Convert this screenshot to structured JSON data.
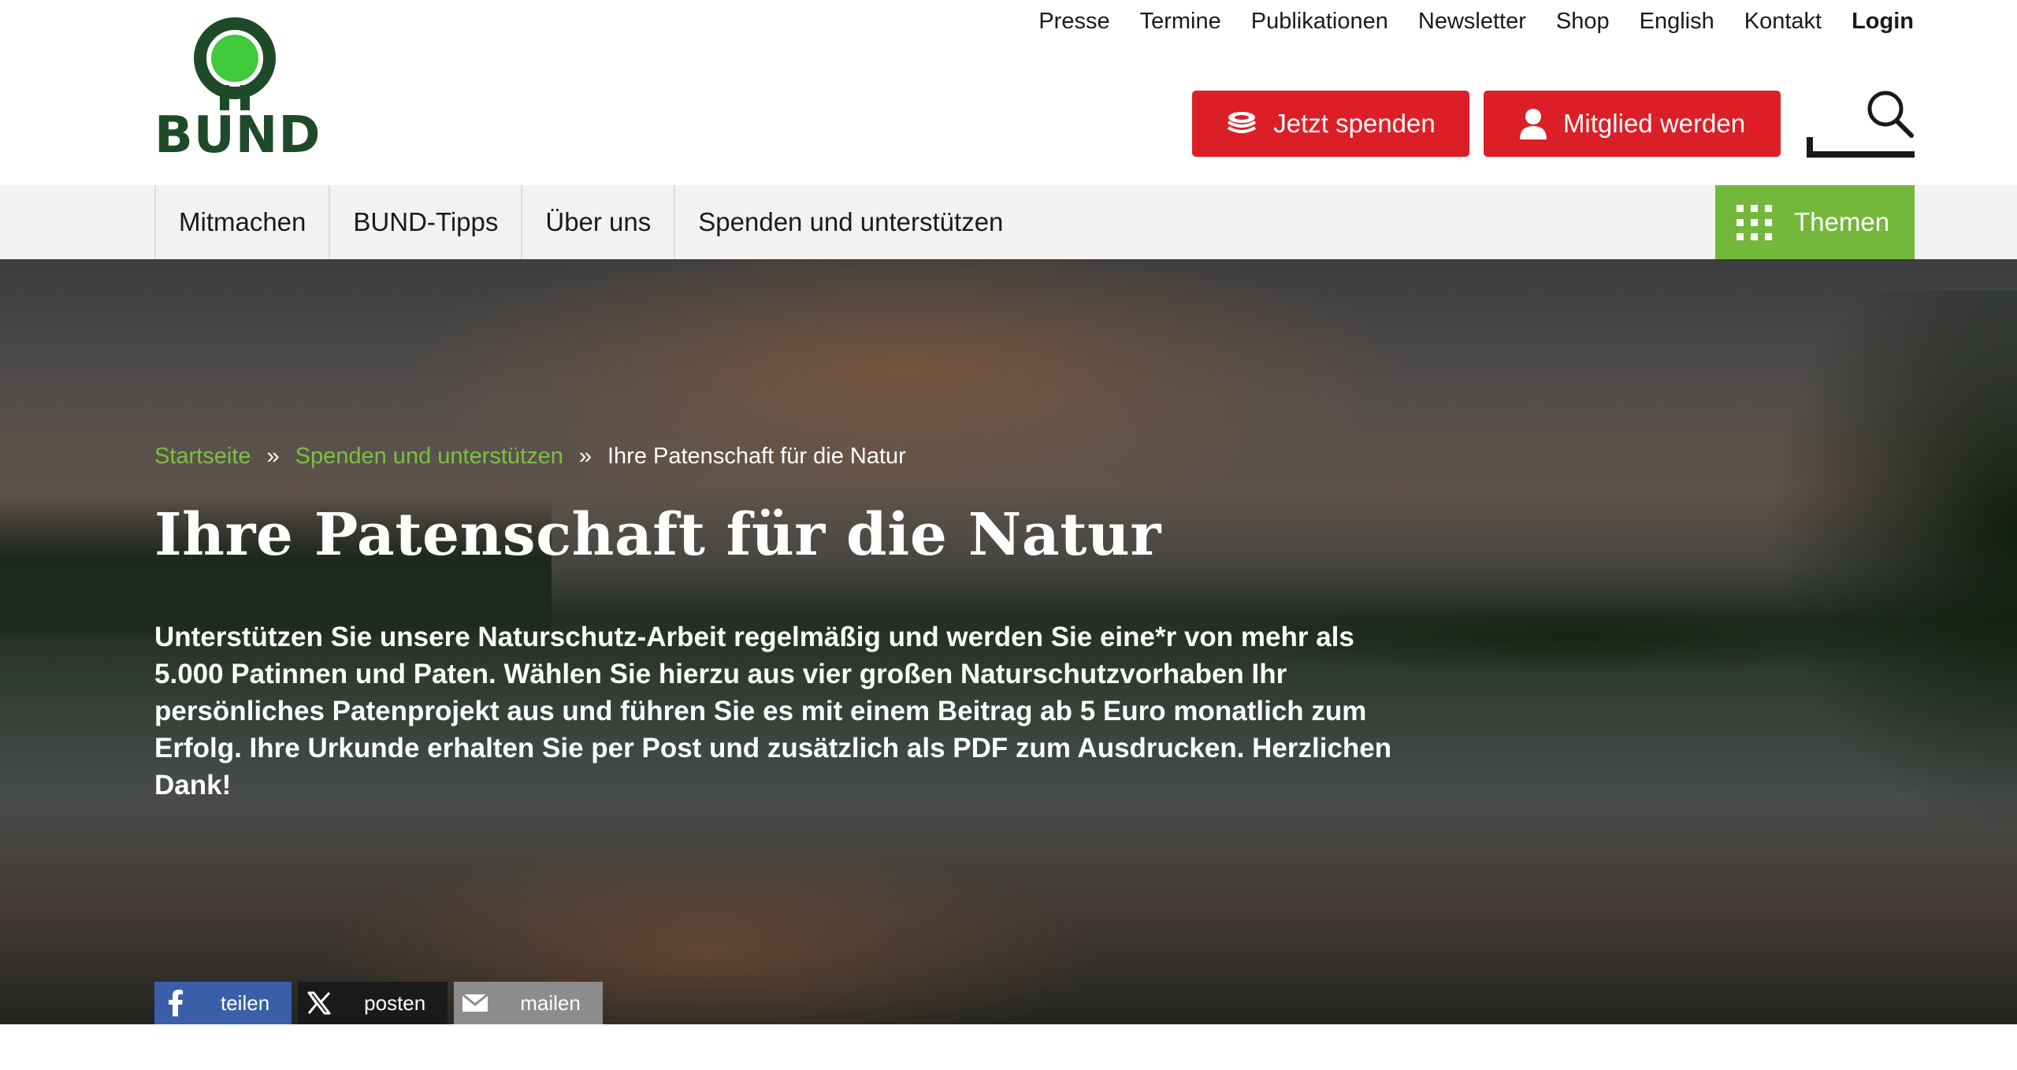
{
  "logo": {
    "text": "BUND",
    "green": "#3fc93b",
    "dark": "#1f4a2a"
  },
  "meta_nav": [
    {
      "label": "Presse"
    },
    {
      "label": "Termine"
    },
    {
      "label": "Publikationen"
    },
    {
      "label": "Newsletter"
    },
    {
      "label": "Shop"
    },
    {
      "label": "English"
    },
    {
      "label": "Kontakt"
    },
    {
      "label": "Login"
    }
  ],
  "cta": {
    "donate_label": "Jetzt spenden",
    "member_label": "Mitglied werden",
    "color": "#dc1f26"
  },
  "search": {
    "icon": "search-icon"
  },
  "main_nav": [
    {
      "label": "Mitmachen"
    },
    {
      "label": "BUND-Tipps"
    },
    {
      "label": "Über uns"
    },
    {
      "label": "Spenden und unterstützen"
    }
  ],
  "themen": {
    "label": "Themen",
    "color": "#74b83b"
  },
  "breadcrumb": {
    "items": [
      "Startseite",
      "Spenden und unterstützen",
      "Ihre Patenschaft für die Natur"
    ],
    "separator": "»"
  },
  "hero": {
    "title": "Ihre Patenschaft für die Natur",
    "lead": "Unterstützen Sie unsere Naturschutz-Arbeit regelmäßig und werden Sie eine*r von mehr als 5.000 Patinnen und Paten. Wählen Sie hierzu aus vier großen Naturschutzvorhaben Ihr persönliches Patenprojekt aus und führen Sie es mit einem Beitrag ab 5 Euro monatlich zum Erfolg. Ihre Urkunde erhalten Sie per Post und zusätzlich als PDF zum Ausdrucken. Herzlichen Dank!"
  },
  "share": [
    {
      "label": "teilen",
      "icon": "facebook-icon"
    },
    {
      "label": "posten",
      "icon": "x-icon"
    },
    {
      "label": "mailen",
      "icon": "mail-icon"
    }
  ]
}
